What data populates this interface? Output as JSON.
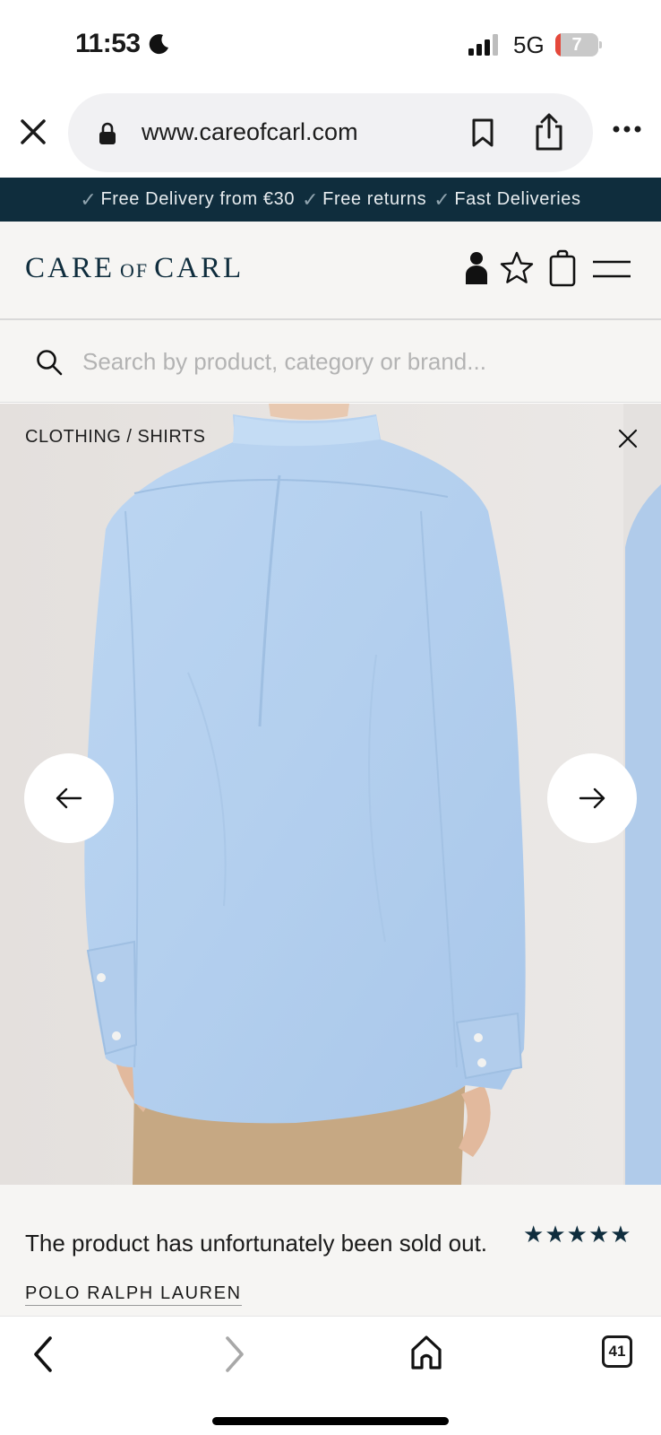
{
  "status_bar": {
    "time": "11:53",
    "network": "5G",
    "battery_level": "7",
    "icons": [
      "moon-icon",
      "signal-icon",
      "battery-icon"
    ]
  },
  "browser": {
    "url": "www.careofcarl.com",
    "icons": [
      "close-icon",
      "lock-icon",
      "bookmark-icon",
      "share-icon",
      "more-icon"
    ]
  },
  "promo_banner": {
    "items": [
      "Free Delivery from €30",
      "Free returns",
      "Fast Deliveries"
    ]
  },
  "site_header": {
    "logo": {
      "part1": "CARE",
      "part2": "OF",
      "part3": "CARL"
    },
    "icons": [
      "user-icon",
      "star-icon",
      "bag-icon",
      "menu-icon"
    ]
  },
  "search": {
    "placeholder": "Search by product, category or brand..."
  },
  "gallery": {
    "breadcrumb": "CLOTHING / SHIRTS",
    "icons": [
      "close-icon",
      "arrow-left-icon",
      "arrow-right-icon"
    ]
  },
  "product": {
    "status_message": "The product has unfortunately been sold out.",
    "brand": "POLO RALPH LAUREN",
    "rating_stars": 5,
    "star_glyph": "★"
  },
  "bottom_toolbar": {
    "tabs_count": "41",
    "icons": [
      "back-icon",
      "forward-icon",
      "home-icon",
      "tabs-icon"
    ]
  },
  "colors": {
    "brand_navy": "#0f2d3d",
    "shirt_blue": "#b7d2ef",
    "battery_low": "#e5483b"
  }
}
